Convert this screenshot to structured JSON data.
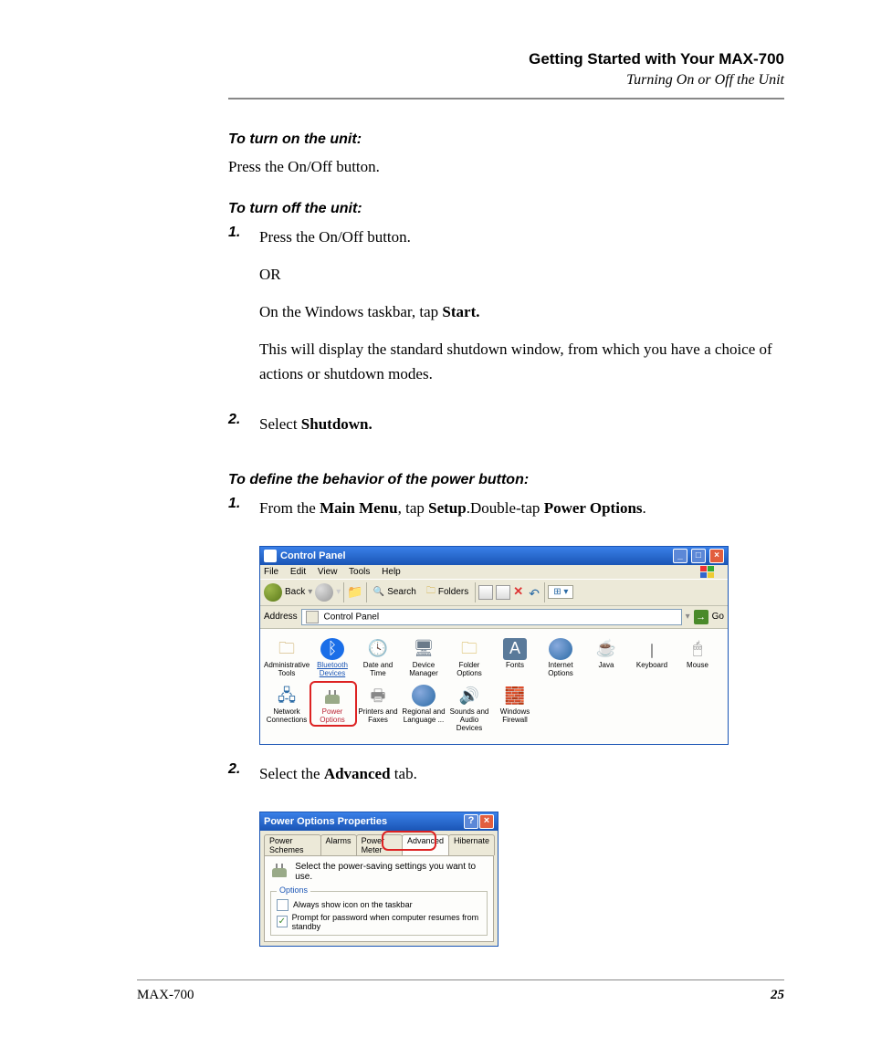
{
  "header": {
    "chapter": "Getting Started with Your MAX-700",
    "section": "Turning On or Off the Unit"
  },
  "h_on": "To turn on the unit:",
  "on_body": "Press the On/Off button.",
  "h_off": "To turn off the unit:",
  "off_steps": {
    "s1": "1.",
    "s1_body1": "Press the On/Off button.",
    "s1_body2": "OR",
    "s1_body3a": "On the Windows taskbar, tap ",
    "s1_body3b": "Start.",
    "s1_body4": "This will display the standard shutdown window, from which you have a choice of actions or shutdown modes.",
    "s2": "2.",
    "s2_body_a": "Select ",
    "s2_body_b": "Shutdown."
  },
  "h_pb": "To define the behavior of the power button:",
  "pb_steps": {
    "s1": "1.",
    "s1_a": "From the ",
    "s1_b": "Main Menu",
    "s1_c": ", tap ",
    "s1_d": "Setup",
    "s1_e": ".Double-tap ",
    "s1_f": "Power Options",
    "s1_g": ".",
    "s2": "2.",
    "s2_a": "Select the ",
    "s2_b": "Advanced",
    "s2_c": " tab."
  },
  "cp": {
    "title": "Control Panel",
    "menu": {
      "file": "File",
      "edit": "Edit",
      "view": "View",
      "tools": "Tools",
      "help": "Help"
    },
    "toolbar": {
      "back": "Back",
      "search": "Search",
      "folders": "Folders"
    },
    "address_label": "Address",
    "address_value": "Control Panel",
    "go": "Go",
    "items": [
      "Administrative Tools",
      "Bluetooth Devices",
      "Date and Time",
      "Device Manager",
      "Folder Options",
      "Fonts",
      "Internet Options",
      "Java",
      "Keyboard",
      "Mouse",
      "Network Connections",
      "Power Options",
      "Printers and Faxes",
      "Regional and Language ...",
      "Sounds and Audio Devices",
      "Windows Firewall"
    ]
  },
  "po": {
    "title": "Power Options Properties",
    "tabs": [
      "Power Schemes",
      "Alarms",
      "Power Meter",
      "Advanced",
      "Hibernate"
    ],
    "intro": "Select the power-saving settings you want to use.",
    "group": "Options",
    "chk1": "Always show icon on the taskbar",
    "chk2": "Prompt for password when computer resumes from standby"
  },
  "footer": {
    "product": "MAX-700",
    "page": "25"
  }
}
